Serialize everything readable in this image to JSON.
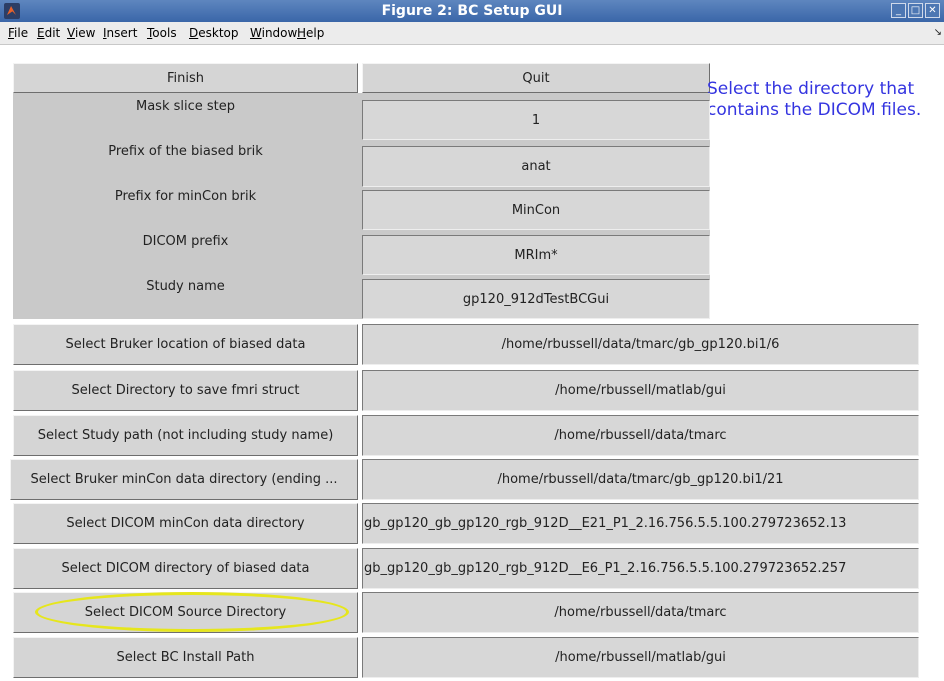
{
  "window": {
    "title": "Figure 2: BC Setup GUI"
  },
  "menu": [
    "File",
    "Edit",
    "View",
    "Insert",
    "Tools",
    "Desktop",
    "Window",
    "Help"
  ],
  "top_buttons": {
    "finish": "Finish",
    "quit": "Quit"
  },
  "help_text": "Select the directory that contains the DICOM files.",
  "params": [
    {
      "label": "Mask slice step",
      "value": "1"
    },
    {
      "label": "Prefix of the biased brik",
      "value": "anat"
    },
    {
      "label": "Prefix for minCon brik",
      "value": "MinCon"
    },
    {
      "label": "DICOM prefix",
      "value": "MRIm*"
    },
    {
      "label": "Study name",
      "value": "gp120_912dTestBCGui"
    }
  ],
  "paths": [
    {
      "button": "Select Bruker location of biased data",
      "value": "/home/rbussell/data/tmarc/gb_gp120.bi1/6"
    },
    {
      "button": "Select Directory to save fmri struct",
      "value": "/home/rbussell/matlab/gui"
    },
    {
      "button": "Select Study path (not including study name)",
      "value": "/home/rbussell/data/tmarc"
    },
    {
      "button": "Select Bruker minCon data directory (ending ...",
      "value": "/home/rbussell/data/tmarc/gb_gp120.bi1/21"
    },
    {
      "button": "Select DICOM minCon data directory",
      "value": "gb_gp120_gb_gp120_rgb_912D__E21_P1_2.16.756.5.5.100.279723652.13"
    },
    {
      "button": "Select DICOM directory of biased data",
      "value": "gb_gp120_gb_gp120_rgb_912D__E6_P1_2.16.756.5.5.100.279723652.257"
    },
    {
      "button": "Select DICOM Source Directory",
      "value": "/home/rbussell/data/tmarc"
    },
    {
      "button": "Select BC Install Path",
      "value": "/home/rbussell/matlab/gui"
    }
  ],
  "colors": {
    "help_text": "#3434e0",
    "highlight": "#e6e61c",
    "titlebar": "#4a74b4"
  }
}
